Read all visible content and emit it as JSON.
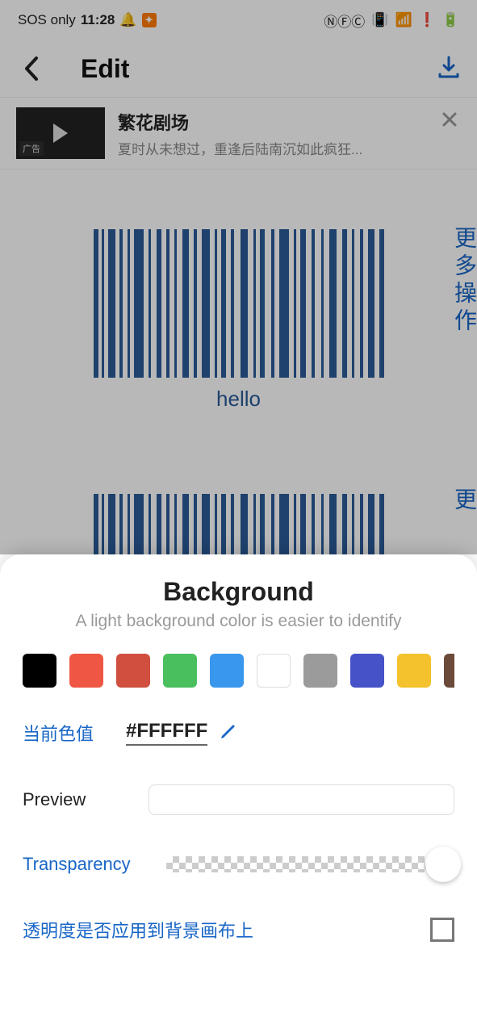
{
  "status": {
    "network": "SOS only",
    "time": "11:28"
  },
  "header": {
    "title": "Edit"
  },
  "ad": {
    "tag": "广告",
    "title": "繁花剧场",
    "subtitle": "夏时从未想过，重逢后陆南沉如此疯狂..."
  },
  "barcode": {
    "label": "hello",
    "color": "#2a5b99"
  },
  "side_action": "更多操作",
  "side_action2": "更",
  "sheet": {
    "title": "Background",
    "subtitle": "A light background color is easier to identify",
    "swatches": [
      "#000000",
      "#ef5644",
      "#d04f3e",
      "#4abf5e",
      "#3a97ee",
      "#ffffff",
      "#9b9b9b",
      "#4552c8",
      "#f3c22c",
      "#6b4a3a"
    ],
    "current_label": "当前色值",
    "current_value": "#FFFFFF",
    "preview_label": "Preview",
    "transparency_label": "Transparency",
    "apply_label": "透明度是否应用到背景画布上"
  }
}
